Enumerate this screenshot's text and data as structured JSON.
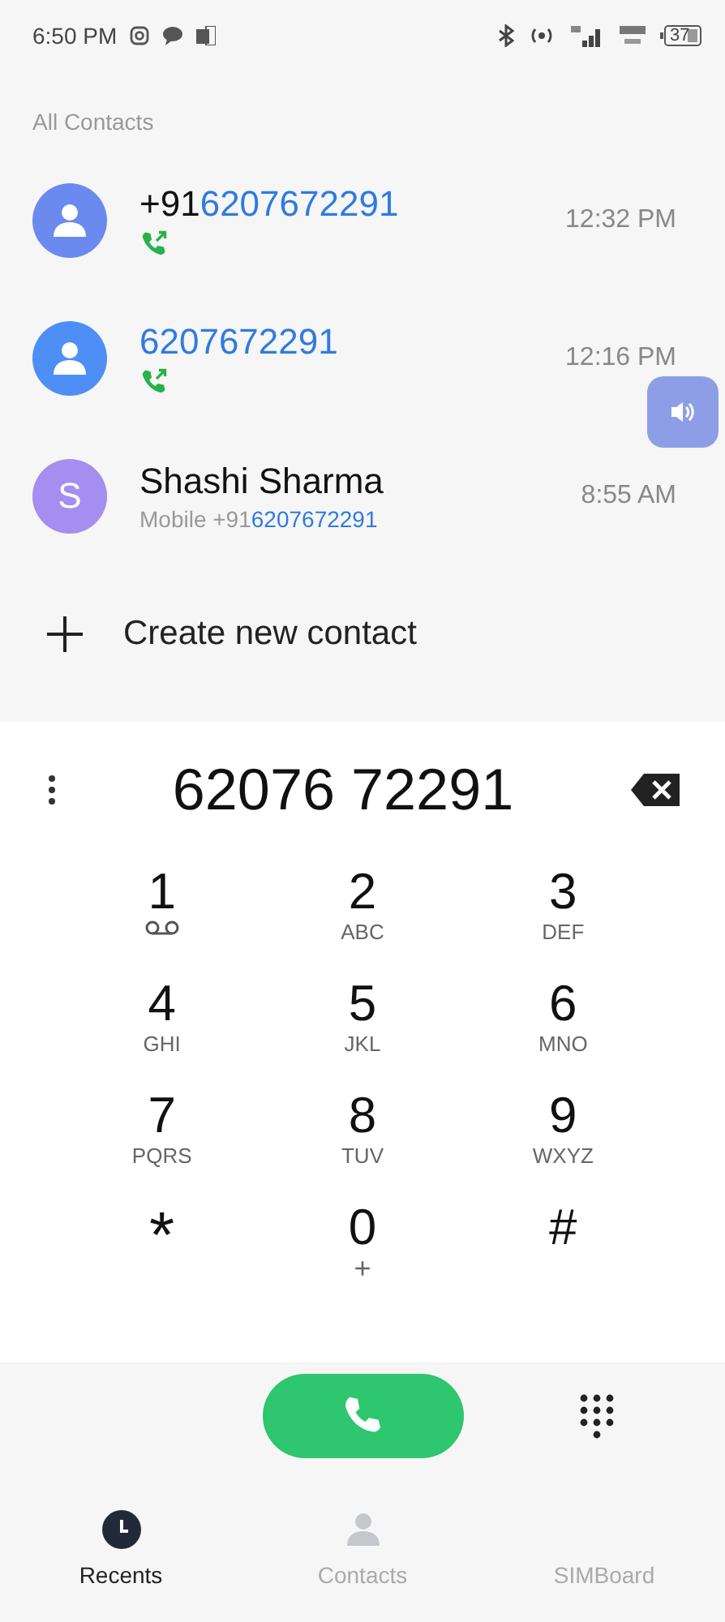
{
  "status_bar": {
    "time": "6:50 PM",
    "battery": "37"
  },
  "section_title": "All Contacts",
  "calls": [
    {
      "kind": "number",
      "color": "#6b8af0",
      "prefix": "+91",
      "number": "6207672291",
      "time": "12:32 PM"
    },
    {
      "kind": "number",
      "color": "#4d8ff5",
      "number": "6207672291",
      "time": "12:16 PM"
    },
    {
      "kind": "contact",
      "color": "#a48ef0",
      "initial": "S",
      "name": "Shashi Sharma",
      "label": "Mobile +91",
      "number": "6207672291",
      "time": "8:55 AM"
    }
  ],
  "create_contact": "Create new contact",
  "dial_number": "62076 72291",
  "keys": [
    {
      "digit": "1",
      "kind": "voicemail"
    },
    {
      "digit": "2",
      "letters": "ABC",
      "kind": "letters"
    },
    {
      "digit": "3",
      "letters": "DEF",
      "kind": "letters"
    },
    {
      "digit": "4",
      "letters": "GHI",
      "kind": "letters"
    },
    {
      "digit": "5",
      "letters": "JKL",
      "kind": "letters"
    },
    {
      "digit": "6",
      "letters": "MNO",
      "kind": "letters"
    },
    {
      "digit": "7",
      "letters": "PQRS",
      "kind": "letters"
    },
    {
      "digit": "8",
      "letters": "TUV",
      "kind": "letters"
    },
    {
      "digit": "9",
      "letters": "WXYZ",
      "kind": "letters"
    },
    {
      "digit": "*",
      "kind": "plain"
    },
    {
      "digit": "0",
      "letters": "+",
      "kind": "letters"
    },
    {
      "digit": "#",
      "kind": "plain"
    }
  ],
  "tabs": [
    {
      "label": "Recents",
      "selected": true
    },
    {
      "label": "Contacts",
      "selected": false
    },
    {
      "label": "SIMBoard",
      "selected": false
    }
  ]
}
